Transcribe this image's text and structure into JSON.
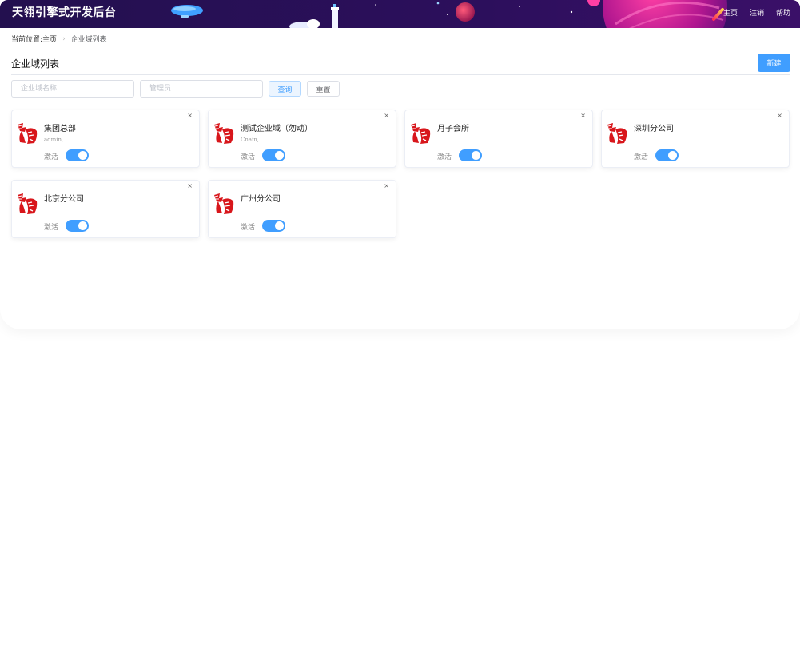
{
  "header": {
    "title": "天翎引擎式开发后台",
    "nav": [
      "主页",
      "注销",
      "帮助"
    ]
  },
  "breadcrumb": {
    "prefix": "当前位置:",
    "home": "主页",
    "current": "企业域列表"
  },
  "page": {
    "title": "企业域列表",
    "new_label": "新建"
  },
  "filters": {
    "domain_placeholder": "企业域名称",
    "admin_placeholder": "管理员",
    "query_label": "查询",
    "reset_label": "重置"
  },
  "cards": [
    {
      "name": "集团总部",
      "admin": "admin,",
      "status": "激活",
      "close": "×",
      "active": true
    },
    {
      "name": "测试企业域（勿动）",
      "admin": "Cnain,",
      "status": "激活",
      "close": "×",
      "active": true
    },
    {
      "name": "月子会所",
      "admin": "",
      "status": "激活",
      "close": "×",
      "active": true
    },
    {
      "name": "深圳分公司",
      "admin": "",
      "status": "激活",
      "close": "×",
      "active": true
    },
    {
      "name": "北京分公司",
      "admin": "",
      "status": "激活",
      "close": "×",
      "active": true
    },
    {
      "name": "广州分公司",
      "admin": "",
      "status": "激活",
      "close": "×",
      "active": true
    }
  ],
  "colors": {
    "header_bg": "#2a0f57",
    "accent": "#409eff",
    "logo_red": "#d8161b"
  },
  "icons": {
    "logo": "tianling-logo-icon",
    "close": "close-icon"
  }
}
